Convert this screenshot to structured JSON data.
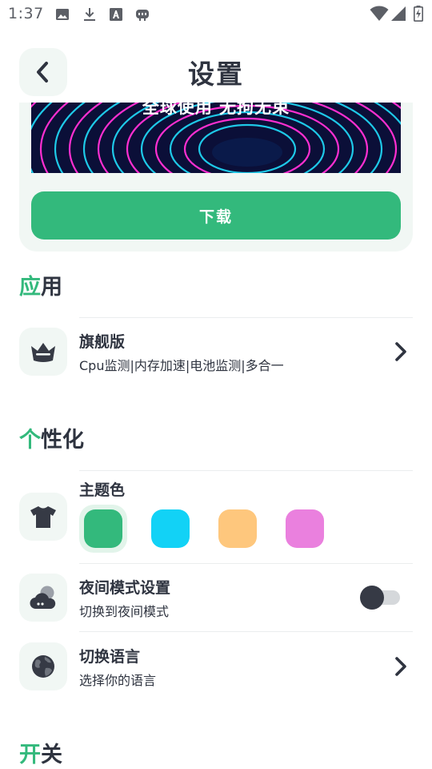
{
  "status_bar": {
    "time": "1:37",
    "icons_left": [
      "image-icon",
      "download-icon",
      "font-icon",
      "game-controller-icon"
    ],
    "icons_right": [
      "wifi-icon",
      "cellular-signal-icon",
      "battery-charging-icon"
    ]
  },
  "header": {
    "title": "设置",
    "back_icon": "chevron-left-icon"
  },
  "banner": {
    "caption": "全球使用 无拘无束",
    "download_label": "下载"
  },
  "sections": {
    "apps": {
      "accent": "应",
      "rest": "用"
    },
    "personalize": {
      "accent": "个",
      "rest": "性化"
    },
    "switches": {
      "accent": "开",
      "rest": "关"
    }
  },
  "flagship": {
    "title": "旗舰版",
    "subtitle": "Cpu监测|内存加速|电池监测|多合一",
    "icon": "crown-icon"
  },
  "theme": {
    "title": "主题色",
    "icon": "tshirt-icon",
    "selected_index": 0,
    "colors": [
      "#33b97c",
      "#12d2f6",
      "#fec77d",
      "#ea80de"
    ]
  },
  "night_mode": {
    "title": "夜间模式设置",
    "subtitle": "切换到夜间模式",
    "icon": "moon-cloud-icon",
    "enabled": false
  },
  "language": {
    "title": "切换语言",
    "subtitle": "选择你的语言",
    "icon": "globe-icon"
  },
  "colors": {
    "accent": "#33b97c",
    "text": "#2f3440",
    "icon_bg": "#f1f7f4"
  }
}
